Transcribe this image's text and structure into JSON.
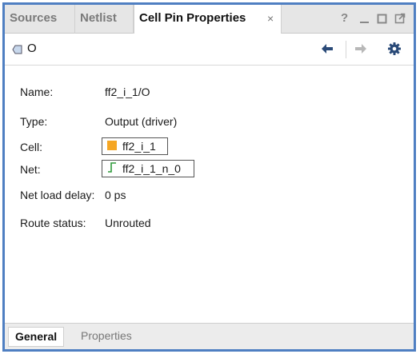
{
  "tabs": [
    {
      "label": "Sources",
      "active": false
    },
    {
      "label": "Netlist",
      "active": false
    },
    {
      "label": "Cell Pin Properties",
      "active": true
    }
  ],
  "window_buttons": [
    "help-icon",
    "minimize-icon",
    "maximize-icon",
    "float-icon"
  ],
  "tab_close_glyph": "×",
  "help_glyph": "?",
  "toolbar": {
    "object_name": "O",
    "icons": [
      "pin-icon",
      "back-arrow-icon",
      "forward-arrow-icon",
      "gear-icon"
    ]
  },
  "properties": {
    "name": {
      "label": "Name:",
      "value": "ff2_i_1/O"
    },
    "type": {
      "label": "Type:",
      "value": "Output (driver)"
    },
    "cell": {
      "label": "Cell:",
      "value": "ff2_i_1"
    },
    "net": {
      "label": "Net:",
      "value": "ff2_i_1_n_0"
    },
    "net_load_delay": {
      "label": "Net load delay:",
      "value": "0 ps"
    },
    "route_status": {
      "label": "Route status:",
      "value": "Unrouted"
    }
  },
  "bottom_tabs": [
    {
      "label": "General",
      "active": true
    },
    {
      "label": "Properties",
      "active": false
    }
  ],
  "colors": {
    "frame": "#4f7fc2",
    "cell_icon": "#f5a623",
    "net_icon": "#2e9a3a",
    "nav_arrow": "#2a4a78",
    "gear": "#2a4a78"
  }
}
